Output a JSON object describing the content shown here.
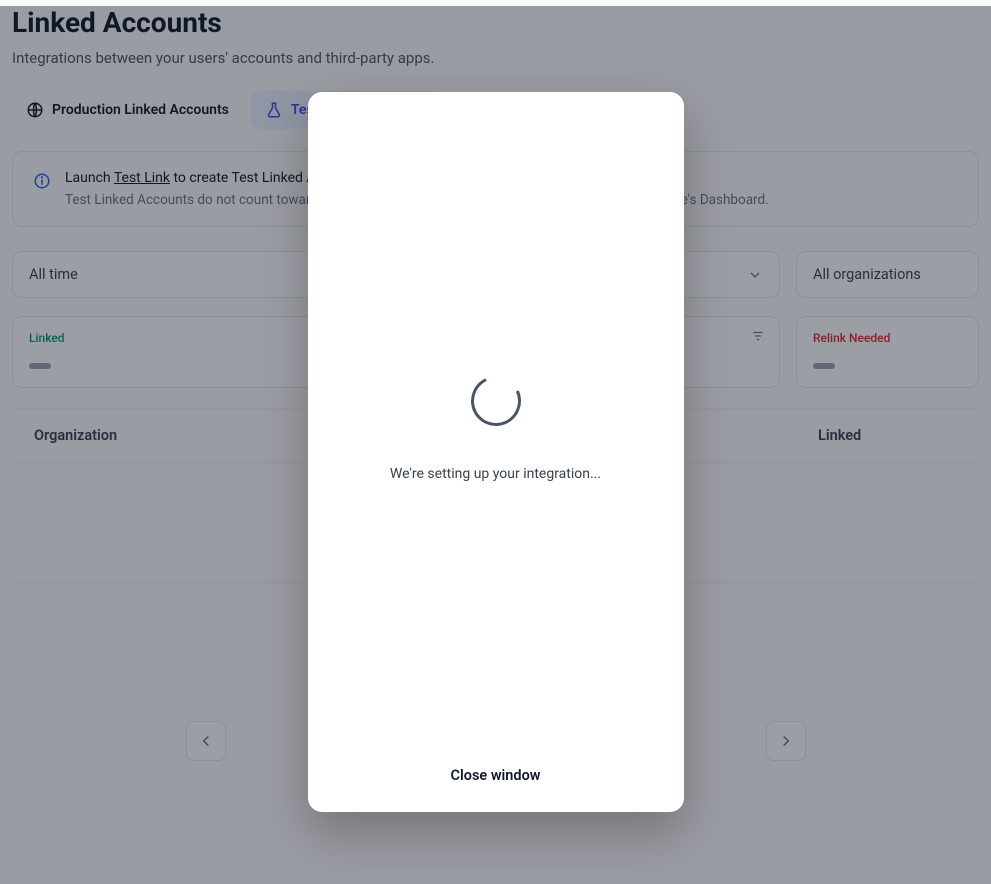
{
  "header": {
    "title": "Linked Accounts",
    "subtitle": "Integrations between your users' accounts and third-party apps."
  },
  "tabs": {
    "production": "Production Linked Accounts",
    "test": "Test Linked Accounts"
  },
  "info": {
    "prefix": "Launch ",
    "link": "Test Link",
    "suffix": " to create Test Linked Accounts.",
    "sub": "Test Linked Accounts do not count towards your Linked Account total and contain sample data in Merge's Dashboard."
  },
  "filters": {
    "time": "All time",
    "org": "All organizations"
  },
  "cards": {
    "linked": {
      "label": "Linked"
    },
    "relink": {
      "label": "Relink Needed"
    }
  },
  "table": {
    "columns": {
      "organization": "Organization",
      "linked": "Linked"
    }
  },
  "modal": {
    "message": "We're setting up your integration...",
    "close": "Close window"
  }
}
